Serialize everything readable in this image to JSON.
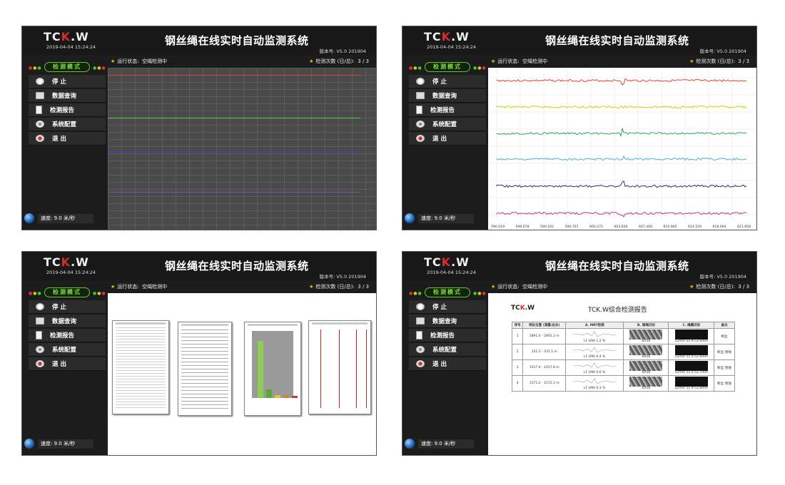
{
  "app": {
    "logo_text": "TCK.W",
    "title": "钢丝绳在线实时自动监测系统",
    "datetime": "2019-04-04 15:24:24",
    "version": "版本号: V5.0 201904",
    "status_label": "运行状态:",
    "status_value": "空绳检测中",
    "count_label": "检测次数 (日/总):",
    "count_value": "3 / 3",
    "mode_label": "检测模式",
    "speed": "速度: 9.0 米/秒"
  },
  "menu": [
    {
      "label": "停  止",
      "icon": "stop-icon"
    },
    {
      "label": "数据查询",
      "icon": "mail-icon"
    },
    {
      "label": "检测报告",
      "icon": "clipboard-icon"
    },
    {
      "label": "系统配置",
      "icon": "gear-icon"
    },
    {
      "label": "退  出",
      "icon": "exit-icon"
    }
  ],
  "waveform": {
    "x_ticks": [
      "596.019",
      "599.678",
      "590.162",
      "596.707",
      "600.271",
      "603.836",
      "607.400",
      "610.965",
      "614.529",
      "618.094",
      "621.658"
    ],
    "channel_colors": [
      "#e8442c",
      "#c8d200",
      "#2fa84a",
      "#45b8b0",
      "#2a2f7a",
      "#b13c8f"
    ]
  },
  "live_chart": {
    "line_colors": [
      "#d64a3a",
      "#4fd04a",
      "#3a3ad6",
      "#8a4ab8"
    ]
  },
  "report": {
    "logo_text": "TCK.W",
    "title": "TCK.W综合检测报告",
    "headers": [
      "序号",
      "特征位置 (测量/总长)",
      "A. MRT检测",
      "B. 钢绳识别",
      "C. 绳槽识别",
      "备注"
    ],
    "rows": [
      {
        "no": "1",
        "pos": "2891.0 - 2891.2 m",
        "note": "断丝",
        "lf": "LF",
        "lma": "LMA",
        "lma_val": "1.2 %",
        "count": "6X56",
        "size": "52mm",
        "range": "51.9-52.6mm"
      },
      {
        "no": "2",
        "pos": "331.2 - 331.5 m",
        "note": "断丝 锈蚀",
        "lf": "LF",
        "lma": "LMA",
        "lma_val": "0.4 %",
        "count": "6X56",
        "size": "52mm",
        "range": "51.5-52.6mm"
      },
      {
        "no": "3",
        "pos": "1017.4 - 1017.8 m",
        "note": "断丝 锈蚀",
        "lf": "LF",
        "lma": "LMA",
        "lma_val": "0.6 %",
        "count": "6X56",
        "size": "52mm",
        "range": "51.5-52.7mm"
      },
      {
        "no": "4",
        "pos": "1571.2 - 1572.1 m",
        "note": "断丝 锈蚀",
        "lf": "LF",
        "lma": "LMA",
        "lma_val": "0.3 %",
        "count": "6X56",
        "size": "52mm",
        "range": "51.9-52.8mm"
      }
    ]
  }
}
